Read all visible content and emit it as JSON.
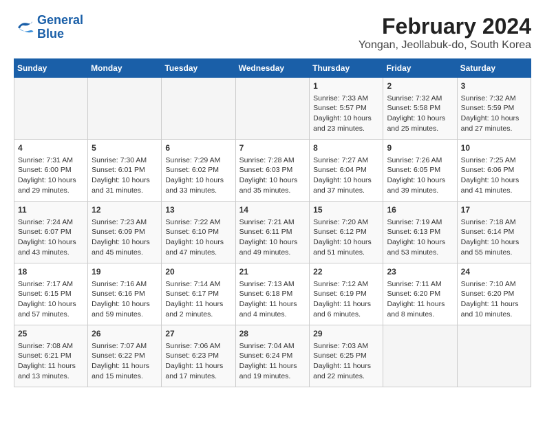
{
  "header": {
    "logo_line1": "General",
    "logo_line2": "Blue",
    "title": "February 2024",
    "subtitle": "Yongan, Jeollabuk-do, South Korea"
  },
  "days_of_week": [
    "Sunday",
    "Monday",
    "Tuesday",
    "Wednesday",
    "Thursday",
    "Friday",
    "Saturday"
  ],
  "weeks": [
    [
      {
        "day": "",
        "info": ""
      },
      {
        "day": "",
        "info": ""
      },
      {
        "day": "",
        "info": ""
      },
      {
        "day": "",
        "info": ""
      },
      {
        "day": "1",
        "info": "Sunrise: 7:33 AM\nSunset: 5:57 PM\nDaylight: 10 hours\nand 23 minutes."
      },
      {
        "day": "2",
        "info": "Sunrise: 7:32 AM\nSunset: 5:58 PM\nDaylight: 10 hours\nand 25 minutes."
      },
      {
        "day": "3",
        "info": "Sunrise: 7:32 AM\nSunset: 5:59 PM\nDaylight: 10 hours\nand 27 minutes."
      }
    ],
    [
      {
        "day": "4",
        "info": "Sunrise: 7:31 AM\nSunset: 6:00 PM\nDaylight: 10 hours\nand 29 minutes."
      },
      {
        "day": "5",
        "info": "Sunrise: 7:30 AM\nSunset: 6:01 PM\nDaylight: 10 hours\nand 31 minutes."
      },
      {
        "day": "6",
        "info": "Sunrise: 7:29 AM\nSunset: 6:02 PM\nDaylight: 10 hours\nand 33 minutes."
      },
      {
        "day": "7",
        "info": "Sunrise: 7:28 AM\nSunset: 6:03 PM\nDaylight: 10 hours\nand 35 minutes."
      },
      {
        "day": "8",
        "info": "Sunrise: 7:27 AM\nSunset: 6:04 PM\nDaylight: 10 hours\nand 37 minutes."
      },
      {
        "day": "9",
        "info": "Sunrise: 7:26 AM\nSunset: 6:05 PM\nDaylight: 10 hours\nand 39 minutes."
      },
      {
        "day": "10",
        "info": "Sunrise: 7:25 AM\nSunset: 6:06 PM\nDaylight: 10 hours\nand 41 minutes."
      }
    ],
    [
      {
        "day": "11",
        "info": "Sunrise: 7:24 AM\nSunset: 6:07 PM\nDaylight: 10 hours\nand 43 minutes."
      },
      {
        "day": "12",
        "info": "Sunrise: 7:23 AM\nSunset: 6:09 PM\nDaylight: 10 hours\nand 45 minutes."
      },
      {
        "day": "13",
        "info": "Sunrise: 7:22 AM\nSunset: 6:10 PM\nDaylight: 10 hours\nand 47 minutes."
      },
      {
        "day": "14",
        "info": "Sunrise: 7:21 AM\nSunset: 6:11 PM\nDaylight: 10 hours\nand 49 minutes."
      },
      {
        "day": "15",
        "info": "Sunrise: 7:20 AM\nSunset: 6:12 PM\nDaylight: 10 hours\nand 51 minutes."
      },
      {
        "day": "16",
        "info": "Sunrise: 7:19 AM\nSunset: 6:13 PM\nDaylight: 10 hours\nand 53 minutes."
      },
      {
        "day": "17",
        "info": "Sunrise: 7:18 AM\nSunset: 6:14 PM\nDaylight: 10 hours\nand 55 minutes."
      }
    ],
    [
      {
        "day": "18",
        "info": "Sunrise: 7:17 AM\nSunset: 6:15 PM\nDaylight: 10 hours\nand 57 minutes."
      },
      {
        "day": "19",
        "info": "Sunrise: 7:16 AM\nSunset: 6:16 PM\nDaylight: 10 hours\nand 59 minutes."
      },
      {
        "day": "20",
        "info": "Sunrise: 7:14 AM\nSunset: 6:17 PM\nDaylight: 11 hours\nand 2 minutes."
      },
      {
        "day": "21",
        "info": "Sunrise: 7:13 AM\nSunset: 6:18 PM\nDaylight: 11 hours\nand 4 minutes."
      },
      {
        "day": "22",
        "info": "Sunrise: 7:12 AM\nSunset: 6:19 PM\nDaylight: 11 hours\nand 6 minutes."
      },
      {
        "day": "23",
        "info": "Sunrise: 7:11 AM\nSunset: 6:20 PM\nDaylight: 11 hours\nand 8 minutes."
      },
      {
        "day": "24",
        "info": "Sunrise: 7:10 AM\nSunset: 6:20 PM\nDaylight: 11 hours\nand 10 minutes."
      }
    ],
    [
      {
        "day": "25",
        "info": "Sunrise: 7:08 AM\nSunset: 6:21 PM\nDaylight: 11 hours\nand 13 minutes."
      },
      {
        "day": "26",
        "info": "Sunrise: 7:07 AM\nSunset: 6:22 PM\nDaylight: 11 hours\nand 15 minutes."
      },
      {
        "day": "27",
        "info": "Sunrise: 7:06 AM\nSunset: 6:23 PM\nDaylight: 11 hours\nand 17 minutes."
      },
      {
        "day": "28",
        "info": "Sunrise: 7:04 AM\nSunset: 6:24 PM\nDaylight: 11 hours\nand 19 minutes."
      },
      {
        "day": "29",
        "info": "Sunrise: 7:03 AM\nSunset: 6:25 PM\nDaylight: 11 hours\nand 22 minutes."
      },
      {
        "day": "",
        "info": ""
      },
      {
        "day": "",
        "info": ""
      }
    ]
  ]
}
